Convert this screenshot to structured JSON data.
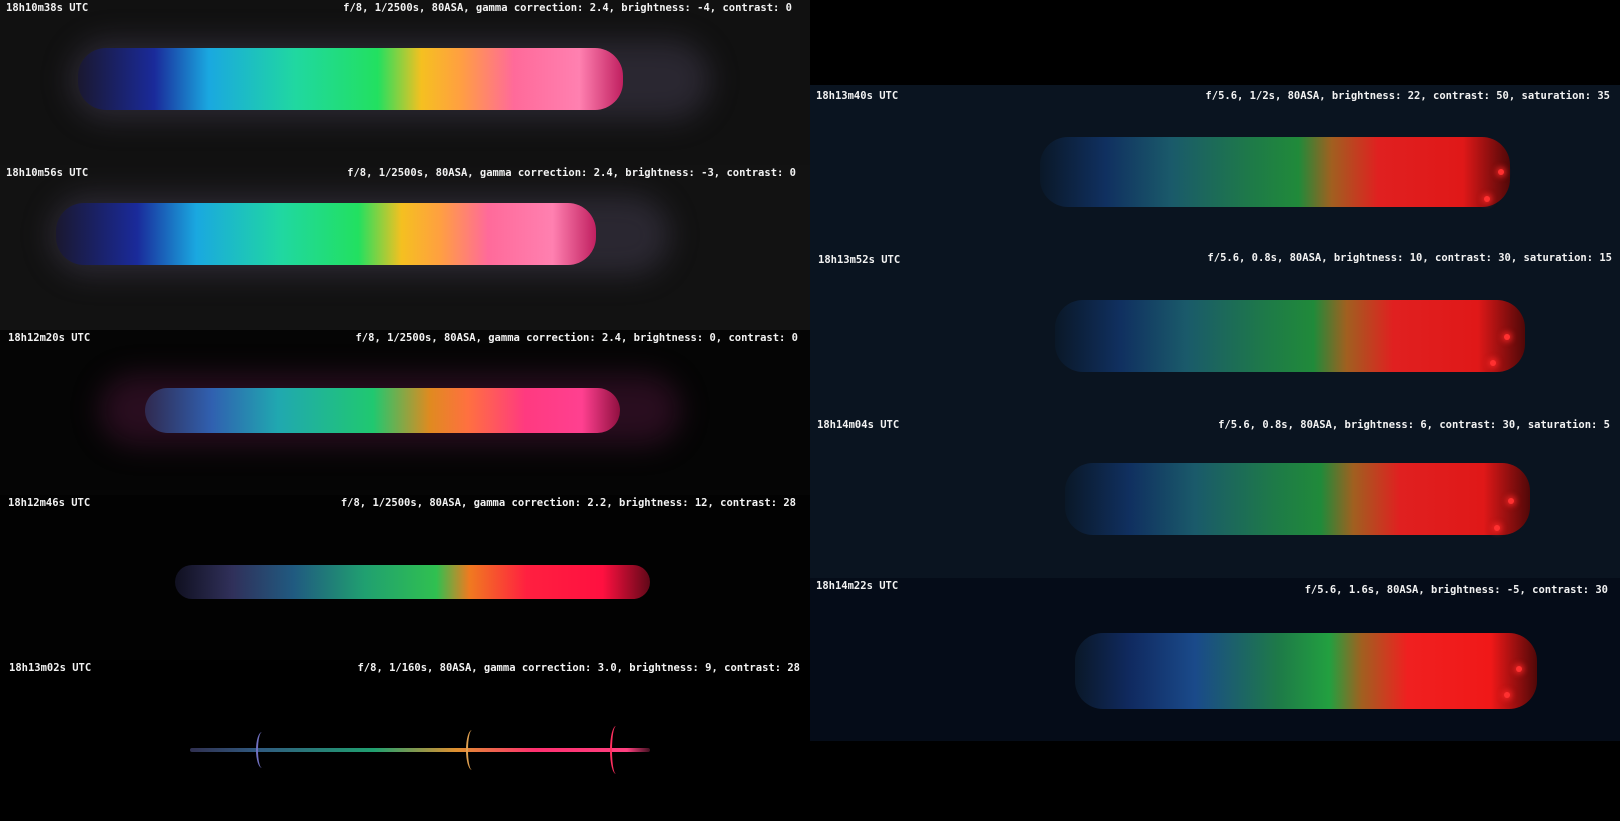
{
  "left_panels": [
    {
      "time": "18h10m38s UTC",
      "params": "f/8, 1/2500s, 80ASA, gamma correction: 2.4, brightness: -4, contrast: 0"
    },
    {
      "time": "18h10m56s UTC",
      "params": "f/8, 1/2500s, 80ASA, gamma correction: 2.4, brightness: -3, contrast: 0"
    },
    {
      "time": "18h12m20s UTC",
      "params": "f/8, 1/2500s, 80ASA, gamma correction: 2.4, brightness: 0, contrast: 0"
    },
    {
      "time": "18h12m46s UTC",
      "params": "f/8, 1/2500s, 80ASA, gamma correction: 2.2, brightness: 12, contrast: 28"
    },
    {
      "time": "18h13m02s UTC",
      "params": "f/8, 1/160s, 80ASA, gamma correction: 3.0, brightness: 9, contrast: 28"
    }
  ],
  "right_panels": [
    {
      "time": "18h13m40s UTC",
      "params": "f/5.6, 1/2s, 80ASA, brightness: 22, contrast: 50, saturation: 35"
    },
    {
      "time": "18h13m52s UTC",
      "params": "f/5.6, 0.8s, 80ASA, brightness: 10, contrast: 30, saturation: 15"
    },
    {
      "time": "18h14m04s UTC",
      "params": "f/5.6, 0.8s, 80ASA, brightness: 6, contrast: 30, saturation: 5"
    },
    {
      "time": "18h14m22s UTC",
      "params": "f/5.6, 1.6s, 80ASA, brightness: -5, contrast: 30"
    }
  ]
}
